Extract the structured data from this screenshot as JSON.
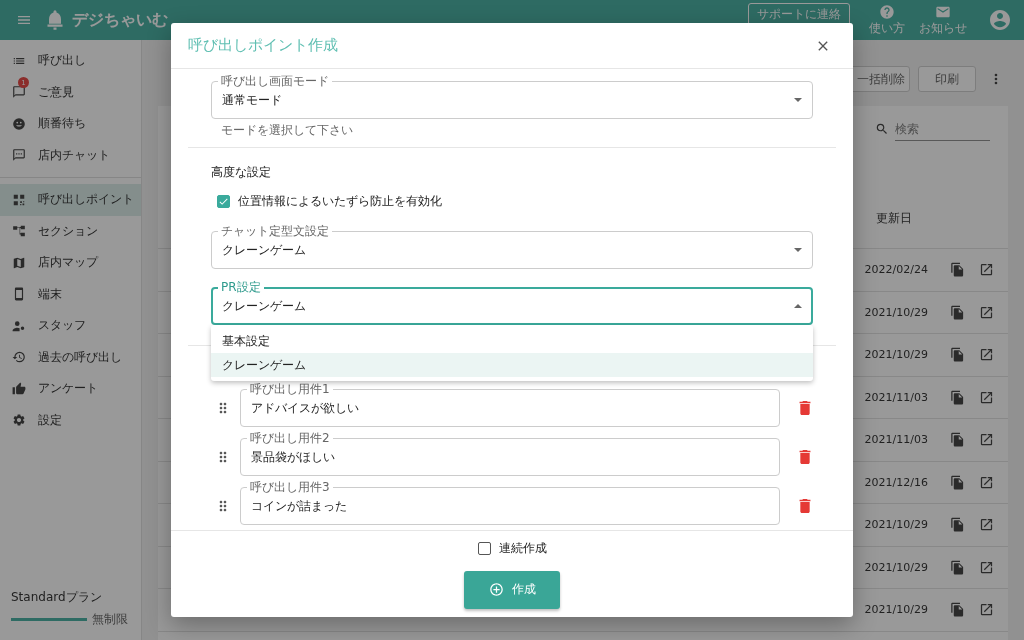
{
  "app_bar": {
    "logo": "デジちゃいむ",
    "support_button": "サポートに連絡",
    "actions": [
      {
        "label": "使い方"
      },
      {
        "label": "お知らせ"
      }
    ]
  },
  "sidebar": {
    "groups": [
      [
        {
          "label": "呼び出し",
          "selected": false
        },
        {
          "label": "ご意見",
          "selected": false,
          "badge": "1"
        },
        {
          "label": "順番待ち",
          "selected": false
        },
        {
          "label": "店内チャット",
          "selected": false
        }
      ],
      [
        {
          "label": "呼び出しポイント",
          "selected": true
        },
        {
          "label": "セクション",
          "selected": false
        },
        {
          "label": "店内マップ",
          "selected": false
        },
        {
          "label": "端末",
          "selected": false
        },
        {
          "label": "スタッフ",
          "selected": false
        },
        {
          "label": "過去の呼び出し",
          "selected": false
        },
        {
          "label": "アンケート",
          "selected": false
        },
        {
          "label": "設定",
          "selected": false
        }
      ]
    ],
    "plan": {
      "name": "Standardプラン",
      "level": 1,
      "limit": "無制限"
    }
  },
  "toolbar": {
    "buttons": [
      "一括削除",
      "印刷"
    ]
  },
  "table": {
    "search": {
      "placeholder": "検索"
    },
    "columns": [
      "更新日"
    ],
    "rows": [
      {
        "updated": "2022/02/24"
      },
      {
        "updated": "2021/10/29"
      },
      {
        "updated": "2021/10/29"
      },
      {
        "updated": "2021/11/03"
      },
      {
        "updated": "2021/11/03"
      },
      {
        "updated": "2021/12/16"
      },
      {
        "updated": "2021/10/29"
      },
      {
        "updated": "2021/10/29"
      },
      {
        "updated": "2021/10/29"
      }
    ]
  },
  "dialog": {
    "title": "呼び出しポイント作成",
    "screen_mode": {
      "label": "呼び出し画面モード",
      "value": "通常モード",
      "hint": "モードを選択して下さい"
    },
    "advanced": {
      "heading": "高度な設定",
      "geo_check": {
        "label": "位置情報によるいたずら防止を有効化",
        "checked": true
      },
      "chat_template": {
        "label": "チャット定型文設定",
        "value": "クレーンゲーム"
      },
      "pr": {
        "label": "PR設定",
        "value": "クレーンゲーム",
        "expanded": true,
        "options": [
          {
            "label": "基本設定",
            "selected": false
          },
          {
            "label": "クレーンゲーム",
            "selected": true
          }
        ]
      }
    },
    "call_items": [
      {
        "label": "呼び出し用件1",
        "value": "アドバイスが欲しい"
      },
      {
        "label": "呼び出し用件2",
        "value": "景品袋がほしい"
      },
      {
        "label": "呼び出し用件3",
        "value": "コインが詰まった"
      }
    ],
    "continuous": {
      "label": "連続作成",
      "checked": false
    },
    "submit": "作成"
  }
}
